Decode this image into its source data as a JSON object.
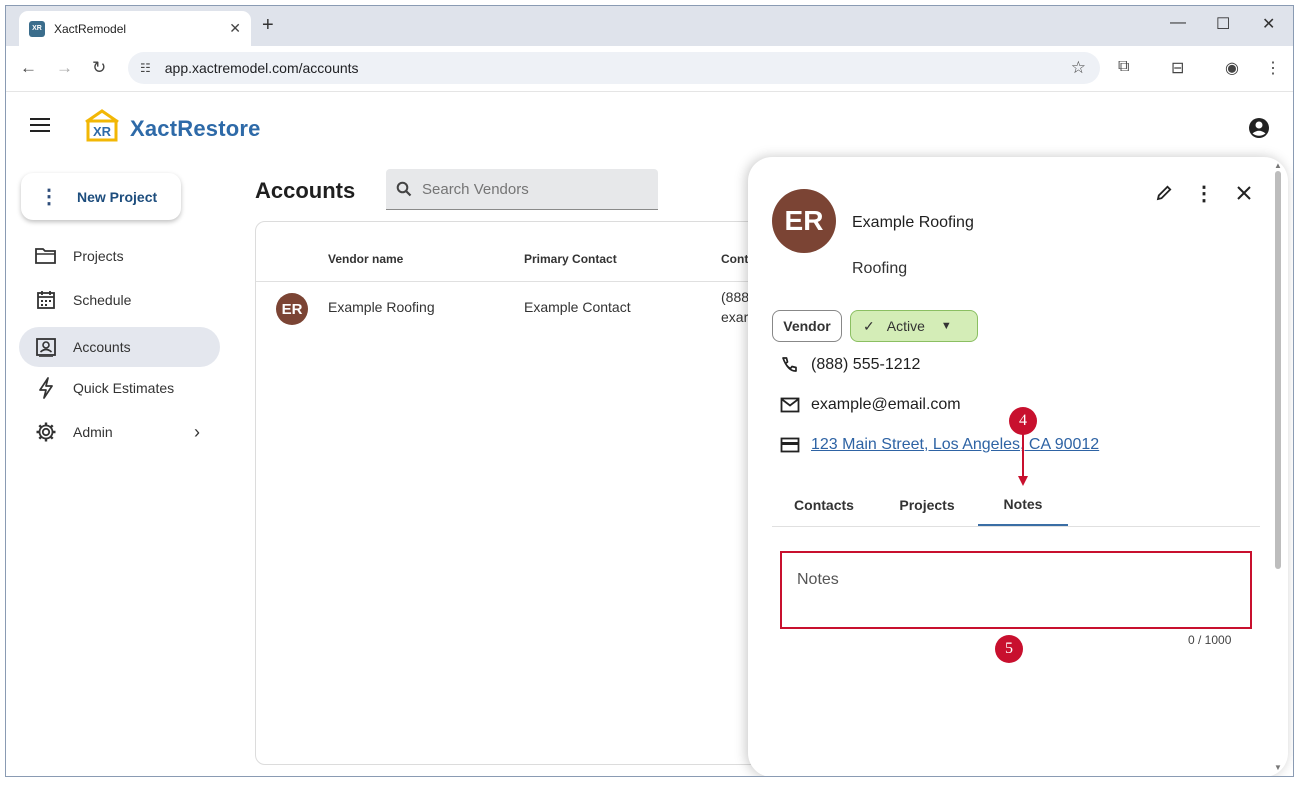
{
  "browser": {
    "tab_title": "XactRemodel",
    "favicon_text": "XR",
    "url": "app.xactremodel.com/accounts"
  },
  "app": {
    "brand": "XactRestore",
    "logo_text": "XR"
  },
  "sidebar": {
    "new_project_label": "New Project",
    "items": [
      {
        "label": "Projects",
        "icon": "folder-icon"
      },
      {
        "label": "Schedule",
        "icon": "calendar-icon"
      },
      {
        "label": "Accounts",
        "icon": "contact-card-icon",
        "active": true
      },
      {
        "label": "Quick Estimates",
        "icon": "lightning-icon"
      },
      {
        "label": "Admin",
        "icon": "gear-icon"
      }
    ]
  },
  "accounts": {
    "title": "Accounts",
    "search_placeholder": "Search Vendors",
    "columns": [
      "Vendor name",
      "Primary Contact",
      "Cont"
    ],
    "rows": [
      {
        "initials": "ER",
        "vendor": "Example Roofing",
        "primary_contact": "Example Contact",
        "contact_line1": "(888",
        "contact_line2": "exar"
      }
    ]
  },
  "panel": {
    "initials": "ER",
    "name": "Example Roofing",
    "type": "Roofing",
    "chip_vendor": "Vendor",
    "chip_status": "Active",
    "phone": "(888) 555-1212",
    "email": "example@email.com",
    "address": "123 Main Street, Los Angeles, CA 90012",
    "tabs": [
      "Contacts",
      "Projects",
      "Notes"
    ],
    "active_tab": "Notes",
    "notes_placeholder": "Notes",
    "notes_counter": "0 / 1000"
  },
  "annotations": {
    "step4": "4",
    "step5": "5",
    "color": "#c8102e"
  }
}
